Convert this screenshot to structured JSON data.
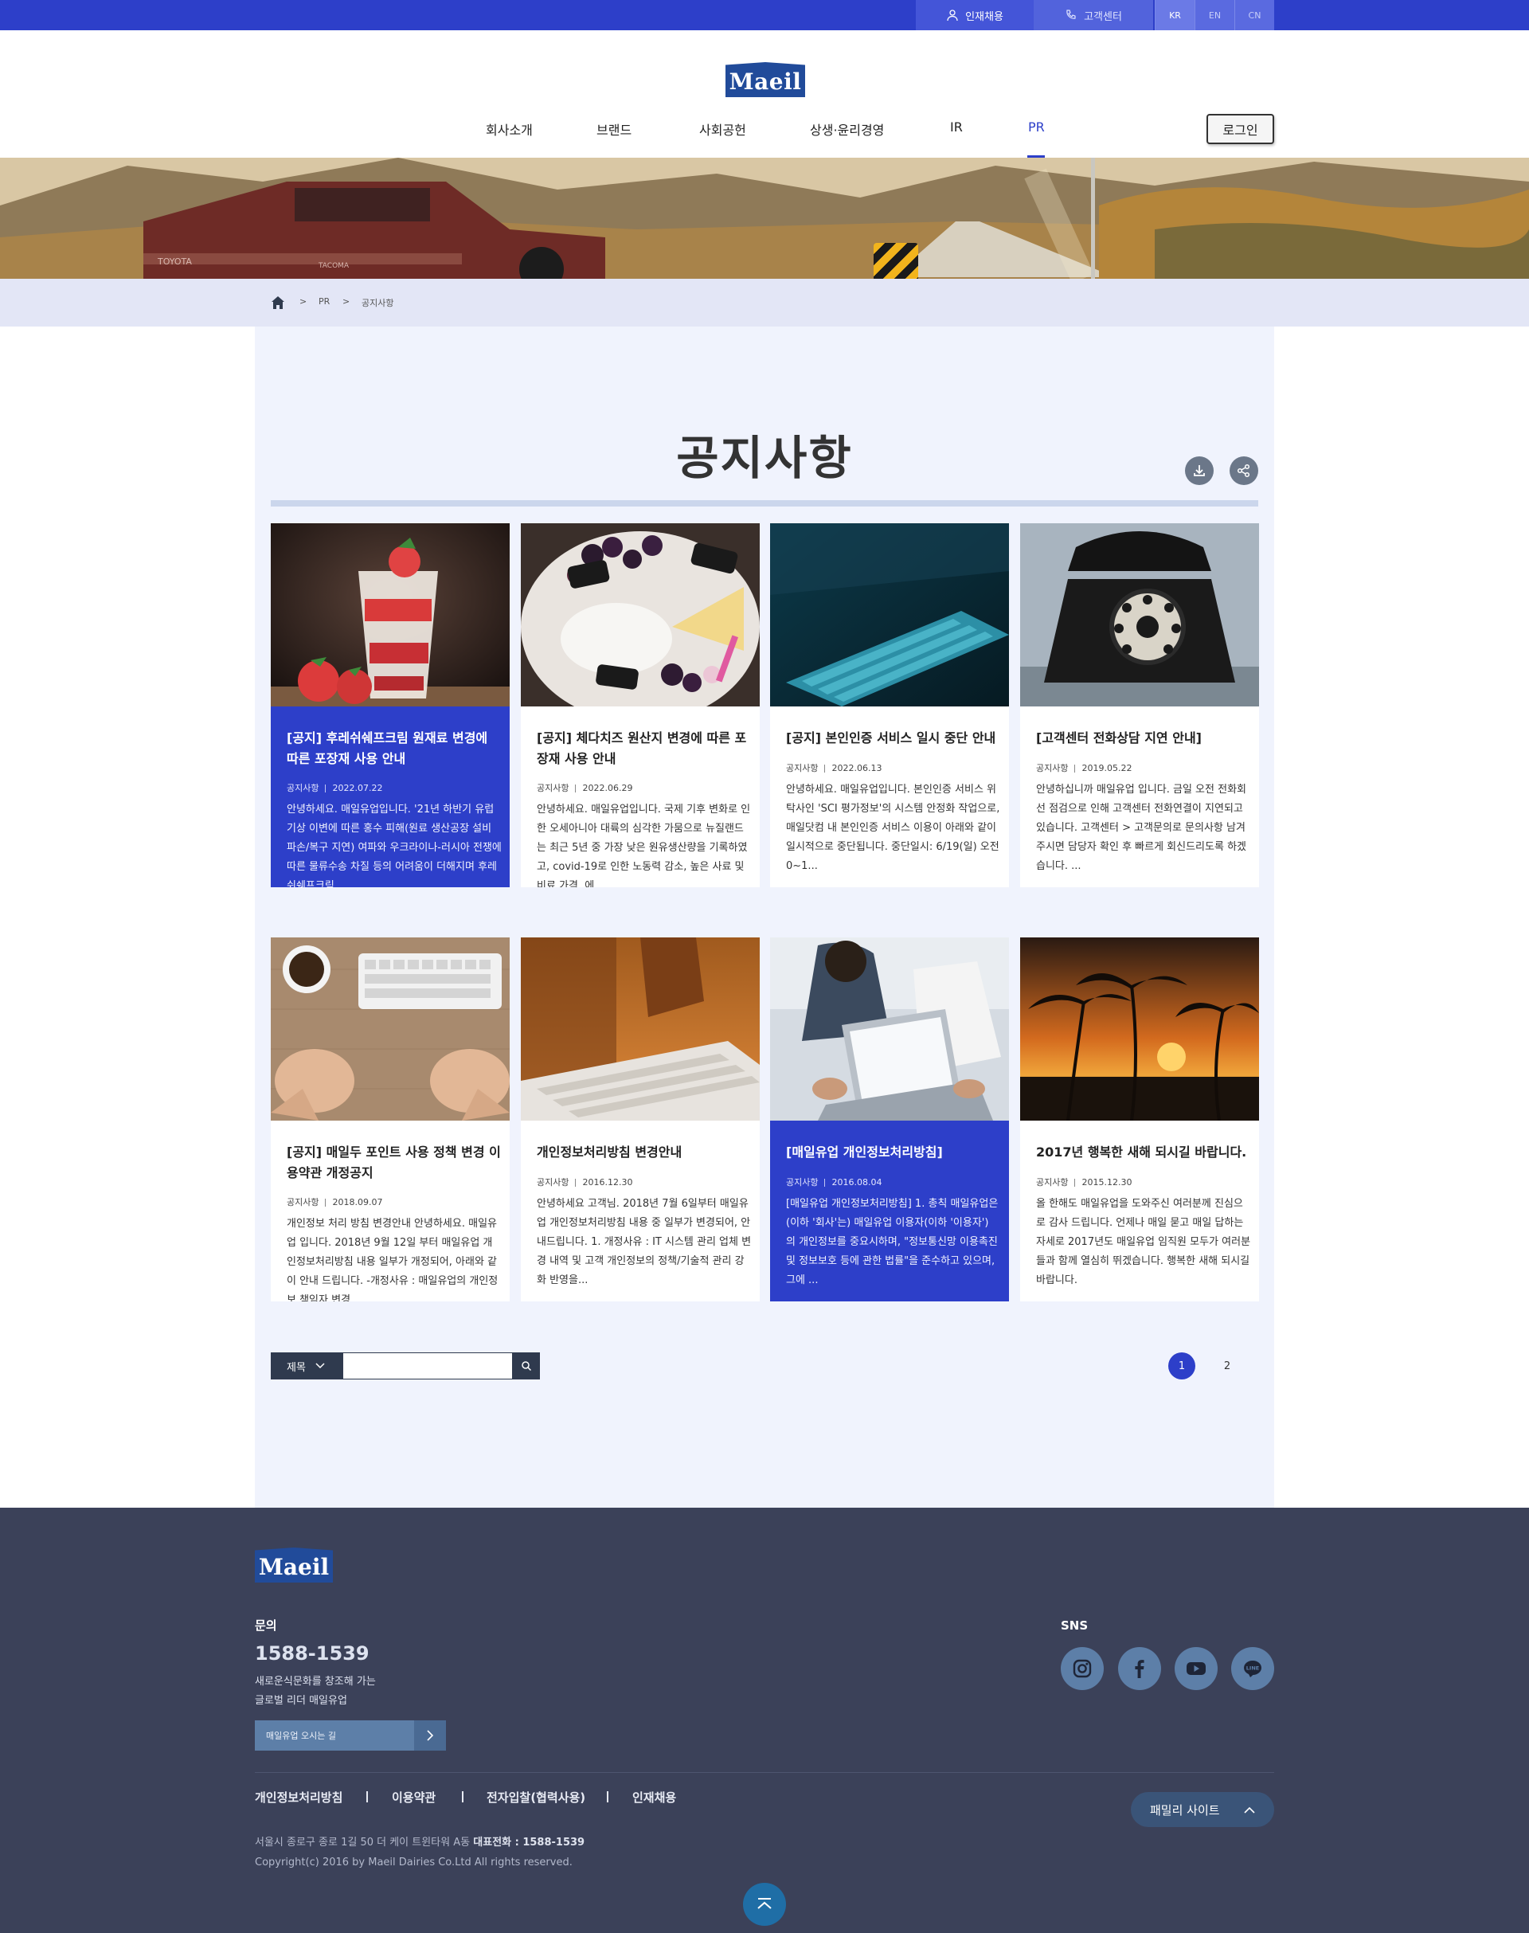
{
  "topbar": {
    "recruit_label": "인재채용",
    "cs_label": "고객센터",
    "languages": [
      "KR",
      "EN",
      "CN"
    ],
    "active_language": "KR"
  },
  "header": {
    "logo_text": "Maeil",
    "nav": [
      "회사소개",
      "브랜드",
      "사회공헌",
      "상생·윤리경영",
      "IR",
      "PR"
    ],
    "active_nav": "PR",
    "login_label": "로그인"
  },
  "breadcrumb": {
    "items": [
      "PR",
      "공지사항"
    ],
    "separator": ">"
  },
  "page_title": "공지사항",
  "cards": [
    {
      "title": "[공지] 후레쉬쉐프크림 원재료 변경에 따른 포장재 사용 안내",
      "category": "공지사항",
      "date": "2022.07.22",
      "excerpt": "안녕하세요. 매일유업입니다. '21년 하반기 유럽기상 이변에 따른 홍수 피해(원료 생산공장 설비 파손/복구 지연) 여파와 우크라이나-러시아 전쟁에 따른 물류수송 차질 등의 어려움이 더해지며 후레쉬쉐프크림...",
      "highlighted": true,
      "image": "strawberry-parfait"
    },
    {
      "title": "[공지] 체다치즈 원산지 변경에 따른 포장재 사용 안내",
      "category": "공지사항",
      "date": "2022.06.29",
      "excerpt": "안녕하세요. 매일유업입니다. 국제 기후 변화로 인한 오세아니아 대륙의 심각한 가뭄으로 뉴질랜드는 최근 5년 중 가장 낮은 원유생산량을 기록하였고, covid-19로 인한 노동력 감소, 높은 사료 및 비료 가격, 에...",
      "highlighted": false,
      "image": "cheese-platter"
    },
    {
      "title": "[공지] 본인인증 서비스 일시 중단 안내",
      "category": "공지사항",
      "date": "2022.06.13",
      "excerpt": "안녕하세요. 매일유업입니다. 본인인증 서비스 위탁사인 'SCI 평가정보'의 시스템 안정화 작업으로, 매일닷컴 내 본인인증 서비스 이용이 아래와 같이 일시적으로 중단됩니다. 중단일시: 6/19(일) 오전 0~1...",
      "highlighted": false,
      "image": "keyboard-blue"
    },
    {
      "title": "[고객센터 전화상담 지연 안내]",
      "category": "공지사항",
      "date": "2019.05.22",
      "excerpt": "안녕하십니까 매일유업 입니다. 금일 오전 전화회선 점검으로 인해 고객센터 전화연결이 지연되고 있습니다. 고객센터 > 고객문의로 문의사항 남겨주시면 담당자 확인 후 빠르게 회신드리도록 하겠습니다. ...",
      "highlighted": false,
      "image": "rotary-phone"
    },
    {
      "title": "[공지] 매일두 포인트 사용 정책 변경 이용약관 개정공지",
      "category": "공지사항",
      "date": "2018.09.07",
      "excerpt": "개인정보 처리 방침 변경안내 안녕하세요. 매일유업 입니다. 2018년 9월 12일 부터 매일유업 개인정보처리방침 내용 일부가 개정되어, 아래와 같이 안내 드립니다. -개정사유 : 매일유업의 개인정보 책임자 변경...",
      "highlighted": false,
      "image": "keyboard-fists"
    },
    {
      "title": "개인정보처리방침 변경안내",
      "category": "공지사항",
      "date": "2016.12.30",
      "excerpt": "안녕하세요 고객님. 2018년 7월 6일부터 매일유업 개인정보처리방침 내용 중 일부가 변경되어, 안내드립니다. 1. 개정사유 : IT 시스템 관리 업체 변경 내역 및 고객 개인정보의 정책/기술적 관리 강화 반영을...",
      "highlighted": false,
      "image": "keyboard-desk"
    },
    {
      "title": "[매일유업 개인정보처리방침]",
      "category": "공지사항",
      "date": "2016.08.04",
      "excerpt": "[매일유업 개인정보처리방침] 1. 총칙 매일유업은 (이하 '회사'는) 매일유업 이용자(이하 '이용자') 의 개인정보를 중요시하며, \"정보통신망 이용촉진 및 정보보호 등에 관한 법률\"을 준수하고 있으며, 그에 ...",
      "highlighted": true,
      "image": "laptop-meeting"
    },
    {
      "title": "2017년 행복한 새해 되시길 바랍니다.",
      "category": "공지사항",
      "date": "2015.12.30",
      "excerpt": "올 한해도 매일유업을 도와주신 여러분께 진심으로 감사 드립니다. 언제나 매일 묻고 매일 답하는 자세로 2017년도 매일유업 임직원 모두가 여러분들과 함께 열심히 뛰겠습니다. 행복한 새해 되시길 바랍니다.",
      "highlighted": false,
      "image": "sunset-palms"
    }
  ],
  "search": {
    "field_label": "제목",
    "value": "",
    "placeholder": ""
  },
  "pagination": {
    "pages": [
      "1",
      "2"
    ],
    "current": "1"
  },
  "footer": {
    "logo_text": "Maeil",
    "inquiry_label": "문의",
    "phone": "1588-1539",
    "slogan_line1": "새로운식문화를 창조해 가는",
    "slogan_line2": "글로벌 리더 매일유업",
    "directions_label": "매일유업 오시는 길",
    "sns_label": "SNS",
    "sns": [
      "instagram-icon",
      "facebook-icon",
      "youtube-icon",
      "line-icon"
    ],
    "links": [
      "개인정보처리방침",
      "이용약관",
      "전자입찰(협력사용)",
      "인재채용"
    ],
    "family_site_label": "패밀리 사이트",
    "address": "서울시 종로구 종로 1길 50 더 케이 트윈타워 A동",
    "rep_phone_label": "대표전화 : 1588-1539",
    "copyright": "Copyright(c) 2016 by Maeil Dairies Co.Ltd All rights reserved."
  },
  "colors": {
    "brand_blue": "#2d3fc9",
    "logo_blue": "#214b9a",
    "footer_bg": "#3b4159",
    "content_bg": "#f0f3fd"
  }
}
